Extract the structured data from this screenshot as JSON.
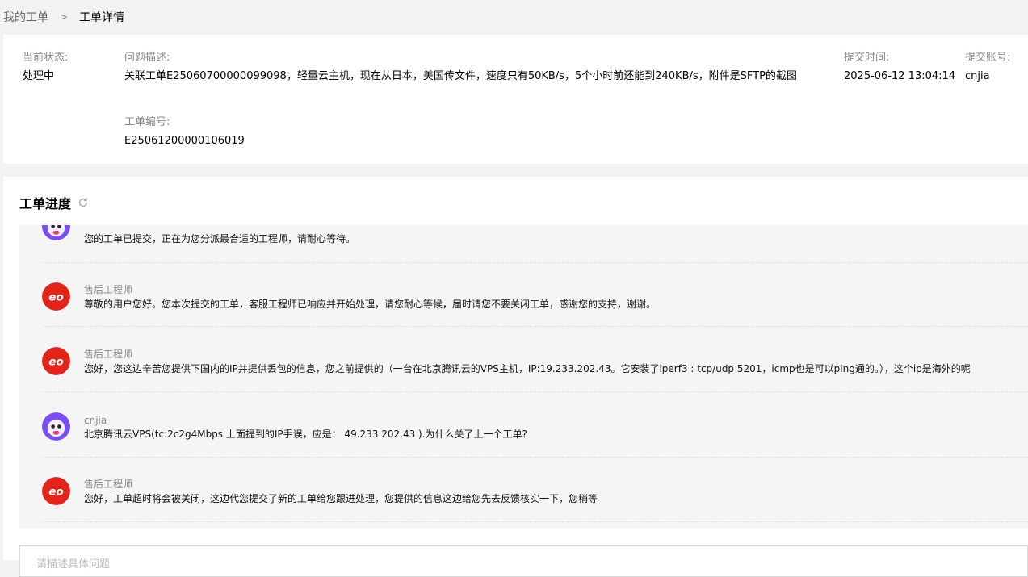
{
  "breadcrumb": {
    "parent": "我的工单",
    "current": "工单详情"
  },
  "ticket": {
    "status_label": "当前状态:",
    "status_value": "处理中",
    "desc_label": "问题描述:",
    "desc_value": "关联工单E25060700000099098，轻量云主机，现在从日本，美国传文件，速度只有50KB/s，5个小时前还能到240KB/s，附件是SFTP的截图",
    "time_label": "提交时间:",
    "time_value": "2025-06-12 13:04:14",
    "account_label": "提交账号:",
    "account_value": "cnjia",
    "id_label": "工单编号:",
    "id_value": "E25061200000106019"
  },
  "progress": {
    "title": "工单进度",
    "entries": [
      {
        "author": "",
        "avatar": "user-avatar",
        "message": "您的工单已提交，正在为您分派最合适的工程师，请耐心等待。"
      },
      {
        "author": "售后工程师",
        "avatar": "engineer-avatar",
        "message": "尊敬的用户您好。您本次提交的工单，客服工程师已响应并开始处理，请您耐心等候，届时请您不要关闭工单，感谢您的支持，谢谢。"
      },
      {
        "author": "售后工程师",
        "avatar": "engineer-avatar",
        "message": "您好，您这边辛苦您提供下国内的IP并提供丢包的信息，您之前提供的（一台在北京腾讯云的VPS主机，IP:19.233.202.43。它安装了iperf3 : tcp/udp 5201，icmp也是可以ping通的。），这个ip是海外的呢"
      },
      {
        "author": "cnjia",
        "avatar": "user-avatar",
        "message": "北京腾讯云VPS(tc:2c2g4Mbps 上面提到的IP手误，应是： 49.233.202.43 ).为什么关了上一个工单?"
      },
      {
        "author": "售后工程师",
        "avatar": "engineer-avatar",
        "message": "您好，工单超时将会被关闭，这边代您提交了新的工单给您跟进处理，您提供的信息这边给您先去反馈核实一下，您稍等"
      }
    ]
  },
  "reply": {
    "placeholder": "请描述具体问题"
  },
  "colors": {
    "engineer_red": "#e1251b",
    "user_purple": "#7b4df2"
  }
}
